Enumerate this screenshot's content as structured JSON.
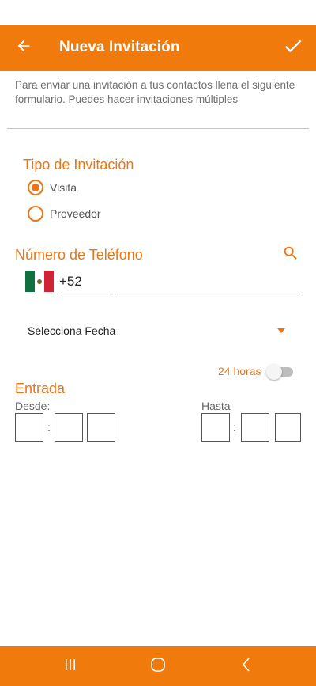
{
  "app_bar": {
    "title": "Nueva Invitación",
    "back_icon": "arrow-left-icon",
    "confirm_icon": "check-icon"
  },
  "intro_text": "Para enviar una invitación a tus contactos llena el siguiente formulario. Puedes hacer invitaciones múltiples",
  "invitation_type": {
    "title": "Tipo de Invitación",
    "options": [
      {
        "label": "Visita",
        "selected": true
      },
      {
        "label": "Proveedor",
        "selected": false
      }
    ]
  },
  "phone": {
    "title": "Número de Teléfono",
    "search_icon": "search-icon",
    "flag_icon": "mexico-flag-icon",
    "country_code": "+52",
    "number": ""
  },
  "date_select": {
    "label": "Selecciona Fecha",
    "icon": "dropdown-arrow-icon"
  },
  "all_day_toggle": {
    "label": "24 horas",
    "on": false
  },
  "entrada": {
    "title": "Entrada",
    "from_label": "Desde:",
    "to_label": "Hasta",
    "separator": ":"
  },
  "nav_bar": {
    "recents_icon": "recents-icon",
    "home_icon": "home-icon",
    "back_icon": "nav-back-icon"
  },
  "colors": {
    "primary": "#f07a0c",
    "accent": "#ec7514",
    "text_secondary": "#6f6f6f"
  }
}
